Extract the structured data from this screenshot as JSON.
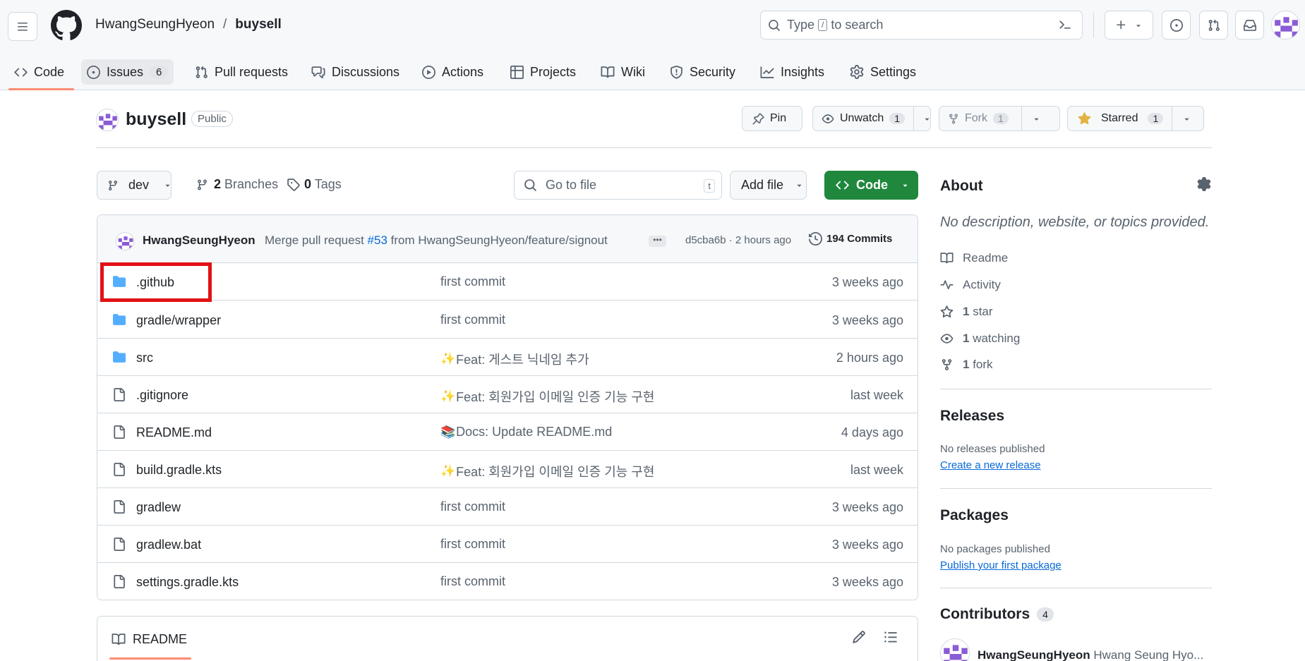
{
  "header": {
    "owner": "HwangSeungHyeon",
    "separator": "/",
    "repo": "buysell",
    "search_prefix": "Type",
    "search_key": "/",
    "search_suffix": "to search"
  },
  "tabs": [
    {
      "label": "Code",
      "icon": "code-icon"
    },
    {
      "label": "Issues",
      "icon": "issue-opened-icon",
      "count": "6"
    },
    {
      "label": "Pull requests",
      "icon": "git-pull-request-icon"
    },
    {
      "label": "Discussions",
      "icon": "comment-discussion-icon"
    },
    {
      "label": "Actions",
      "icon": "play-icon"
    },
    {
      "label": "Projects",
      "icon": "table-icon"
    },
    {
      "label": "Wiki",
      "icon": "book-icon"
    },
    {
      "label": "Security",
      "icon": "shield-icon"
    },
    {
      "label": "Insights",
      "icon": "graph-icon"
    },
    {
      "label": "Settings",
      "icon": "gear-icon"
    }
  ],
  "repo_head": {
    "name": "buysell",
    "visibility": "Public",
    "pin_label": "Pin",
    "unwatch_label": "Unwatch",
    "watch_count": "1",
    "fork_label": "Fork",
    "fork_count": "1",
    "star_label": "Starred",
    "star_count": "1"
  },
  "toolbar": {
    "branch": "dev",
    "branches_count": "2",
    "branches_label": "Branches",
    "tags_count": "0",
    "tags_label": "Tags",
    "goto_placeholder": "Go to file",
    "goto_key": "t",
    "add_file_label": "Add file",
    "code_label": "Code"
  },
  "latest_commit": {
    "author": "HwangSeungHyeon",
    "message_prefix": "Merge pull request",
    "pr_link": "#53",
    "message_suffix": "from HwangSeungHyeon/feature/signout",
    "ellipsis": "•••",
    "hash_time": "d5cba6b · 2 hours ago",
    "commits_label": "194 Commits"
  },
  "files": [
    {
      "type": "folder",
      "name": ".github",
      "emoji": "",
      "message": "first commit",
      "date": "3 weeks ago"
    },
    {
      "type": "folder",
      "name": "gradle/wrapper",
      "emoji": "",
      "message": "first commit",
      "date": "3 weeks ago"
    },
    {
      "type": "folder",
      "name": "src",
      "emoji": "✨",
      "message": "Feat: 게스트 닉네임 추가",
      "date": "2 hours ago"
    },
    {
      "type": "file",
      "name": ".gitignore",
      "emoji": "✨",
      "message": "Feat: 회원가입 이메일 인증 기능 구현",
      "date": "last week"
    },
    {
      "type": "file",
      "name": "README.md",
      "emoji": "📚",
      "message": "Docs: Update README.md",
      "date": "4 days ago"
    },
    {
      "type": "file",
      "name": "build.gradle.kts",
      "emoji": "✨",
      "message": "Feat: 회원가입 이메일 인증 기능 구현",
      "date": "last week"
    },
    {
      "type": "file",
      "name": "gradlew",
      "emoji": "",
      "message": "first commit",
      "date": "3 weeks ago"
    },
    {
      "type": "file",
      "name": "gradlew.bat",
      "emoji": "",
      "message": "first commit",
      "date": "3 weeks ago"
    },
    {
      "type": "file",
      "name": "settings.gradle.kts",
      "emoji": "",
      "message": "first commit",
      "date": "3 weeks ago"
    }
  ],
  "readme": {
    "label": "README"
  },
  "about": {
    "title": "About",
    "description": "No description, website, or topics provided.",
    "readme_label": "Readme",
    "activity_label": "Activity",
    "stars_count": "1",
    "stars_label": "star",
    "watching_count": "1",
    "watching_label": "watching",
    "forks_count": "1",
    "forks_label": "fork"
  },
  "releases": {
    "title": "Releases",
    "note": "No releases published",
    "link": "Create a new release"
  },
  "packages": {
    "title": "Packages",
    "note": "No packages published",
    "link": "Publish your first package"
  },
  "contributors": {
    "title": "Contributors",
    "count": "4",
    "first_login": "HwangSeungHyeon",
    "first_name": "Hwang Seung Hyo..."
  },
  "colors": {
    "accent_green": "#1f883d",
    "link_blue": "#0969da",
    "folder_blue": "#54aeff",
    "tab_underline": "#fd8c73",
    "highlight_red": "#e11116"
  }
}
